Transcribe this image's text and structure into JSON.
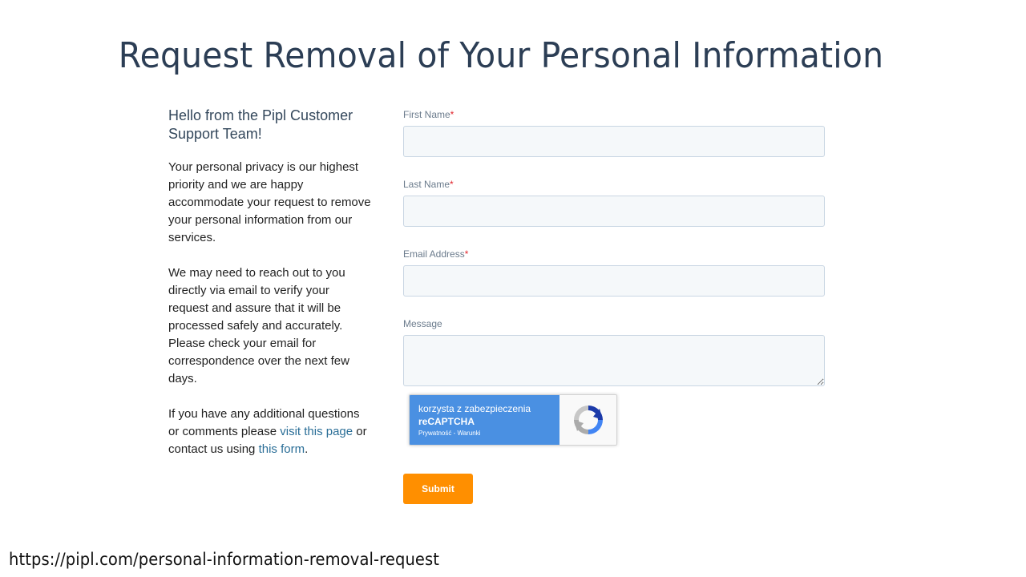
{
  "title": "Request Removal of Your Personal Information",
  "intro": {
    "greeting": "Hello from the Pipl Customer Support Team!",
    "paragraph1": "Your personal privacy is our highest priority and we are happy accommodate your request to remove your personal information from our services.",
    "paragraph2": "We may need to reach out to you directly via email to verify your request and assure that it will be processed safely and accurately. Please check your email for correspondence over the next few days.",
    "paragraph3_before": "If you have any additional questions or comments please ",
    "link1": "visit this page",
    "paragraph3_middle": " or contact us using ",
    "link2": "this form",
    "paragraph3_after": "."
  },
  "form": {
    "first_name_label": "First Name",
    "last_name_label": "Last Name",
    "email_label": "Email Address",
    "message_label": "Message",
    "required_marker": "*",
    "first_name_value": "",
    "last_name_value": "",
    "email_value": "",
    "message_value": "",
    "submit_label": "Submit"
  },
  "recaptcha": {
    "line1": "korzysta z zabezpieczenia",
    "line2": "reCAPTCHA",
    "links": "Prywatność - Warunki",
    "icon": "recaptcha-logo-icon"
  },
  "footer_url": "https://pipl.com/personal-information-removal-request",
  "colors": {
    "title": "#2c3e55",
    "link": "#2a6e97",
    "submit_bg": "#ff8f00",
    "recaptcha_bg": "#4a90e2",
    "required": "#e0262d"
  }
}
